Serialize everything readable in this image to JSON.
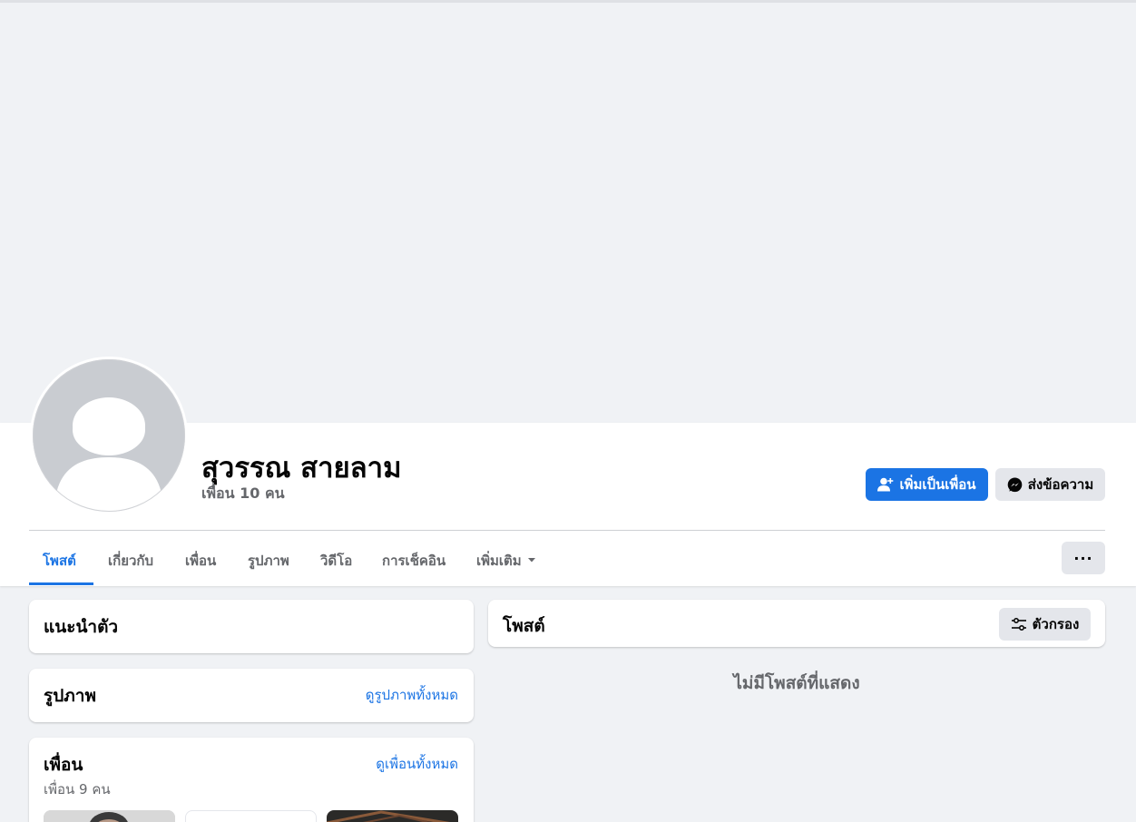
{
  "profile": {
    "name": "สุวรรณ สายลาม",
    "friends_count": "เพื่อน 10 คน"
  },
  "actions": {
    "add_friend_label": "เพิ่มเป็นเพื่อน",
    "message_label": "ส่งข้อความ",
    "more_label": "···"
  },
  "tabs": [
    {
      "label": "โพสต์"
    },
    {
      "label": "เกี่ยวกับ"
    },
    {
      "label": "เพื่อน"
    },
    {
      "label": "รูปภาพ"
    },
    {
      "label": "วิดีโอ"
    },
    {
      "label": "การเช็คอิน"
    },
    {
      "label": "เพิ่มเติม"
    }
  ],
  "intro": {
    "title": "แนะนำตัว"
  },
  "photos": {
    "title": "รูปภาพ",
    "see_all": "ดูรูปภาพทั้งหมด"
  },
  "friends": {
    "title": "เพื่อน",
    "see_all": "ดูเพื่อนทั้งหมด",
    "count": "เพื่อน 9 คน"
  },
  "posts": {
    "title": "โพสต์",
    "filter_label": "ตัวกรอง",
    "empty_text": "ไม่มีโพสต์ที่แสดง"
  },
  "colors": {
    "accent": "#1b74e4",
    "background": "#f0f2f5",
    "secondary_text": "#65676b"
  },
  "icons": [
    "add-friend-icon",
    "messenger-icon",
    "chevron-down-icon",
    "filter-icon",
    "more-icon",
    "default-avatar-icon"
  ]
}
